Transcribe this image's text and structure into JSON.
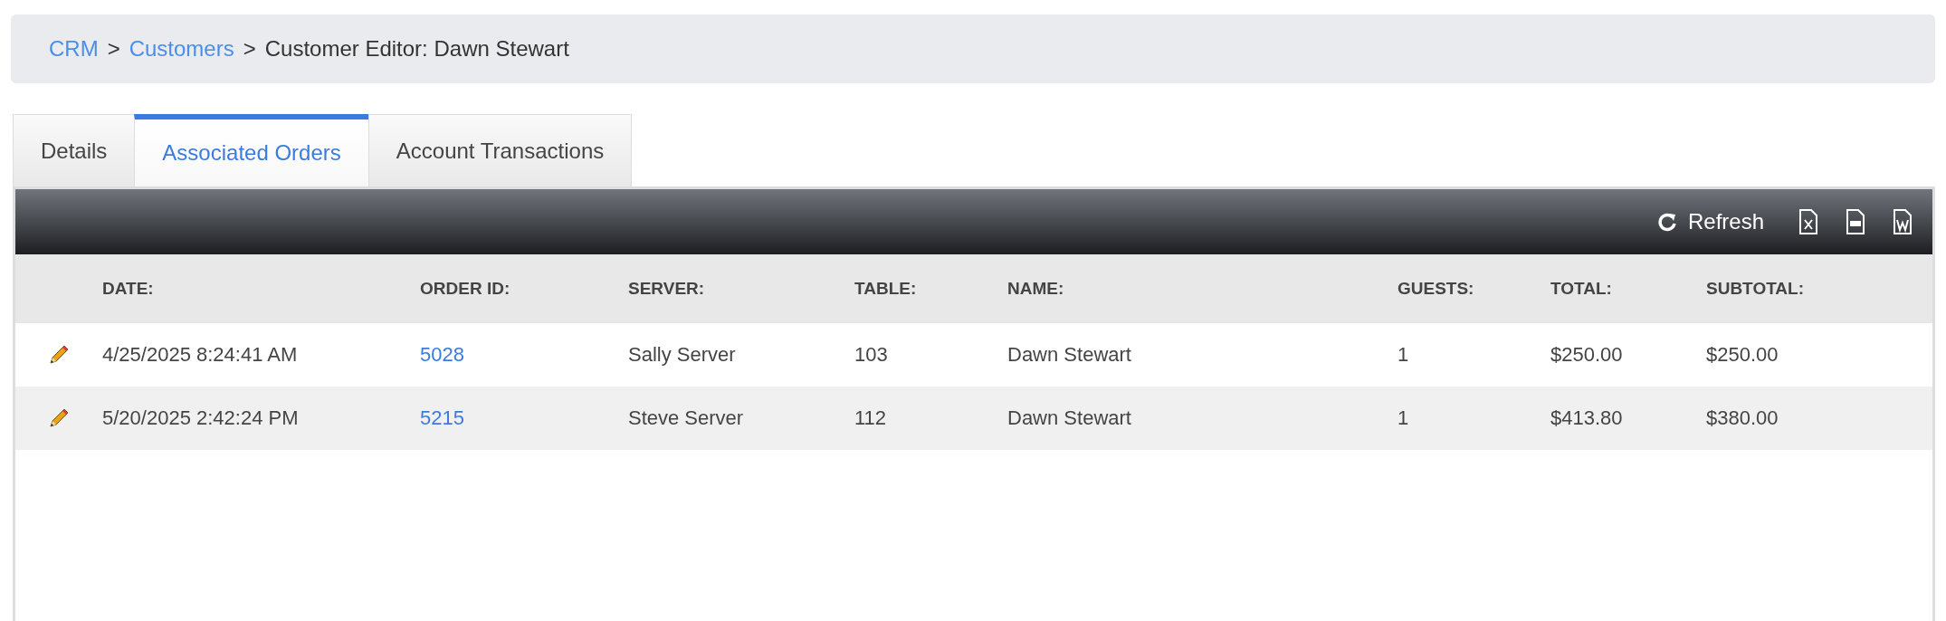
{
  "breadcrumb": [
    {
      "label": "CRM",
      "kind": "link"
    },
    {
      "label": "Customers",
      "kind": "link"
    },
    {
      "label": "Customer Editor: Dawn Stewart",
      "kind": "current"
    }
  ],
  "separator": ">",
  "tabs": [
    {
      "label": "Details",
      "selected": false
    },
    {
      "label": "Associated Orders",
      "selected": true
    },
    {
      "label": "Account Transactions",
      "selected": false
    }
  ],
  "toolbar": {
    "refresh": "Refresh"
  },
  "table": {
    "columns": [
      "DATE:",
      "ORDER ID:",
      "SERVER:",
      "TABLE:",
      "NAME:",
      "GUESTS:",
      "TOTAL:",
      "SUBTOTAL:"
    ],
    "rows": [
      [
        "4/25/2025 8:24:41 AM",
        "5028",
        "Sally Server",
        "103",
        "Dawn Stewart",
        "1",
        "$250.00",
        "$250.00"
      ],
      [
        "5/20/2025 2:42:24 PM",
        "5215",
        "Steve Server",
        "112",
        "Dawn Stewart",
        "1",
        "$413.80",
        "$380.00"
      ]
    ]
  }
}
